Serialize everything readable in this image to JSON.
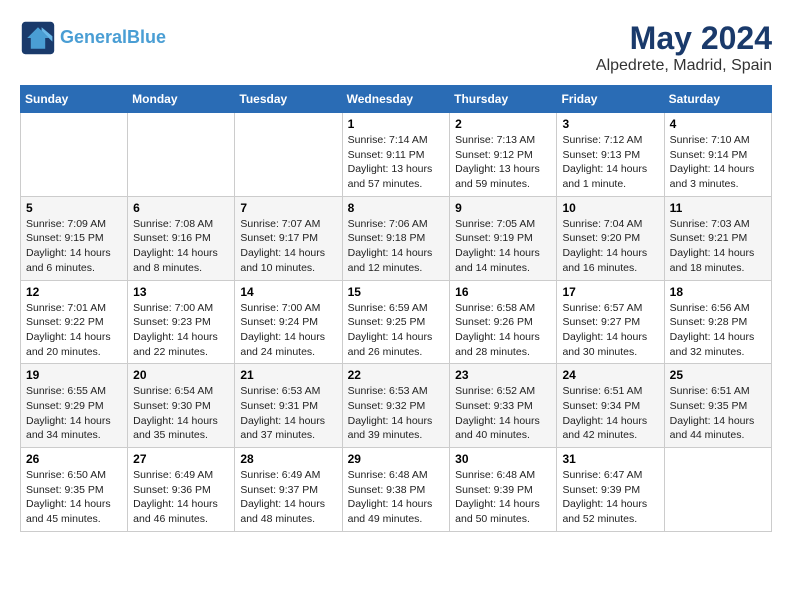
{
  "header": {
    "logo_line1": "General",
    "logo_line2": "Blue",
    "month": "May 2024",
    "location": "Alpedrete, Madrid, Spain"
  },
  "weekdays": [
    "Sunday",
    "Monday",
    "Tuesday",
    "Wednesday",
    "Thursday",
    "Friday",
    "Saturday"
  ],
  "weeks": [
    [
      {
        "day": "",
        "info": ""
      },
      {
        "day": "",
        "info": ""
      },
      {
        "day": "",
        "info": ""
      },
      {
        "day": "1",
        "info": "Sunrise: 7:14 AM\nSunset: 9:11 PM\nDaylight: 13 hours and 57 minutes."
      },
      {
        "day": "2",
        "info": "Sunrise: 7:13 AM\nSunset: 9:12 PM\nDaylight: 13 hours and 59 minutes."
      },
      {
        "day": "3",
        "info": "Sunrise: 7:12 AM\nSunset: 9:13 PM\nDaylight: 14 hours and 1 minute."
      },
      {
        "day": "4",
        "info": "Sunrise: 7:10 AM\nSunset: 9:14 PM\nDaylight: 14 hours and 3 minutes."
      }
    ],
    [
      {
        "day": "5",
        "info": "Sunrise: 7:09 AM\nSunset: 9:15 PM\nDaylight: 14 hours and 6 minutes."
      },
      {
        "day": "6",
        "info": "Sunrise: 7:08 AM\nSunset: 9:16 PM\nDaylight: 14 hours and 8 minutes."
      },
      {
        "day": "7",
        "info": "Sunrise: 7:07 AM\nSunset: 9:17 PM\nDaylight: 14 hours and 10 minutes."
      },
      {
        "day": "8",
        "info": "Sunrise: 7:06 AM\nSunset: 9:18 PM\nDaylight: 14 hours and 12 minutes."
      },
      {
        "day": "9",
        "info": "Sunrise: 7:05 AM\nSunset: 9:19 PM\nDaylight: 14 hours and 14 minutes."
      },
      {
        "day": "10",
        "info": "Sunrise: 7:04 AM\nSunset: 9:20 PM\nDaylight: 14 hours and 16 minutes."
      },
      {
        "day": "11",
        "info": "Sunrise: 7:03 AM\nSunset: 9:21 PM\nDaylight: 14 hours and 18 minutes."
      }
    ],
    [
      {
        "day": "12",
        "info": "Sunrise: 7:01 AM\nSunset: 9:22 PM\nDaylight: 14 hours and 20 minutes."
      },
      {
        "day": "13",
        "info": "Sunrise: 7:00 AM\nSunset: 9:23 PM\nDaylight: 14 hours and 22 minutes."
      },
      {
        "day": "14",
        "info": "Sunrise: 7:00 AM\nSunset: 9:24 PM\nDaylight: 14 hours and 24 minutes."
      },
      {
        "day": "15",
        "info": "Sunrise: 6:59 AM\nSunset: 9:25 PM\nDaylight: 14 hours and 26 minutes."
      },
      {
        "day": "16",
        "info": "Sunrise: 6:58 AM\nSunset: 9:26 PM\nDaylight: 14 hours and 28 minutes."
      },
      {
        "day": "17",
        "info": "Sunrise: 6:57 AM\nSunset: 9:27 PM\nDaylight: 14 hours and 30 minutes."
      },
      {
        "day": "18",
        "info": "Sunrise: 6:56 AM\nSunset: 9:28 PM\nDaylight: 14 hours and 32 minutes."
      }
    ],
    [
      {
        "day": "19",
        "info": "Sunrise: 6:55 AM\nSunset: 9:29 PM\nDaylight: 14 hours and 34 minutes."
      },
      {
        "day": "20",
        "info": "Sunrise: 6:54 AM\nSunset: 9:30 PM\nDaylight: 14 hours and 35 minutes."
      },
      {
        "day": "21",
        "info": "Sunrise: 6:53 AM\nSunset: 9:31 PM\nDaylight: 14 hours and 37 minutes."
      },
      {
        "day": "22",
        "info": "Sunrise: 6:53 AM\nSunset: 9:32 PM\nDaylight: 14 hours and 39 minutes."
      },
      {
        "day": "23",
        "info": "Sunrise: 6:52 AM\nSunset: 9:33 PM\nDaylight: 14 hours and 40 minutes."
      },
      {
        "day": "24",
        "info": "Sunrise: 6:51 AM\nSunset: 9:34 PM\nDaylight: 14 hours and 42 minutes."
      },
      {
        "day": "25",
        "info": "Sunrise: 6:51 AM\nSunset: 9:35 PM\nDaylight: 14 hours and 44 minutes."
      }
    ],
    [
      {
        "day": "26",
        "info": "Sunrise: 6:50 AM\nSunset: 9:35 PM\nDaylight: 14 hours and 45 minutes."
      },
      {
        "day": "27",
        "info": "Sunrise: 6:49 AM\nSunset: 9:36 PM\nDaylight: 14 hours and 46 minutes."
      },
      {
        "day": "28",
        "info": "Sunrise: 6:49 AM\nSunset: 9:37 PM\nDaylight: 14 hours and 48 minutes."
      },
      {
        "day": "29",
        "info": "Sunrise: 6:48 AM\nSunset: 9:38 PM\nDaylight: 14 hours and 49 minutes."
      },
      {
        "day": "30",
        "info": "Sunrise: 6:48 AM\nSunset: 9:39 PM\nDaylight: 14 hours and 50 minutes."
      },
      {
        "day": "31",
        "info": "Sunrise: 6:47 AM\nSunset: 9:39 PM\nDaylight: 14 hours and 52 minutes."
      },
      {
        "day": "",
        "info": ""
      }
    ]
  ]
}
